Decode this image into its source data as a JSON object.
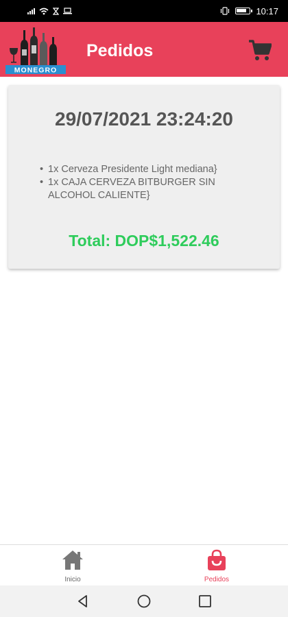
{
  "status_bar": {
    "time": "10:17",
    "battery_level": 0.85,
    "signal_bars": 3
  },
  "app_bar": {
    "logo_text": "MONEGRO",
    "title": "Pedidos",
    "cart_icon": "shopping-cart-icon"
  },
  "order": {
    "date": "29/07/2021 23:24:20",
    "items": [
      "1x Cerveza Presidente Light mediana}",
      "1x CAJA CERVEZA BITBURGER SIN ALCOHOL CALIENTE}"
    ],
    "total": "Total: DOP$1,522.46"
  },
  "bottom_nav": {
    "items": [
      {
        "label": "Inicio",
        "icon": "home-icon",
        "active": false
      },
      {
        "label": "Pedidos",
        "icon": "shopping-bag-icon",
        "active": true
      }
    ]
  },
  "colors": {
    "primary": "#e8415a",
    "total_green": "#2ecc5b",
    "card_bg": "#efefef",
    "date_text": "#555555"
  },
  "system_nav": {
    "icons": [
      "back-icon",
      "home-circle-icon",
      "recents-icon"
    ]
  }
}
